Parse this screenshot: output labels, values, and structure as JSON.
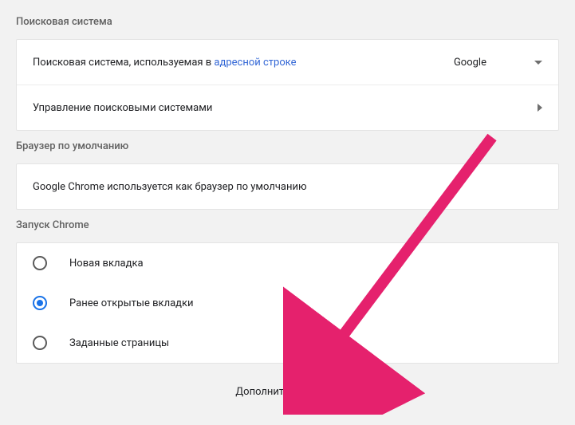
{
  "search_engine": {
    "section_title": "Поисковая система",
    "used_in_label_prefix": "Поисковая система, используемая в ",
    "used_in_link_text": "адресной строке",
    "selected_engine": "Google",
    "manage_label": "Управление поисковыми системами"
  },
  "default_browser": {
    "section_title": "Браузер по умолчанию",
    "status_text": "Google Chrome используется как браузер по умолчанию"
  },
  "startup": {
    "section_title": "Запуск Chrome",
    "options": [
      {
        "label": "Новая вкладка",
        "selected": false
      },
      {
        "label": "Ранее открытые вкладки",
        "selected": true
      },
      {
        "label": "Заданные страницы",
        "selected": false
      }
    ]
  },
  "advanced": {
    "label": "Дополнительные"
  },
  "colors": {
    "link": "#3367d6",
    "radio_selected": "#1a73e8",
    "arrow": "#e5216d"
  }
}
